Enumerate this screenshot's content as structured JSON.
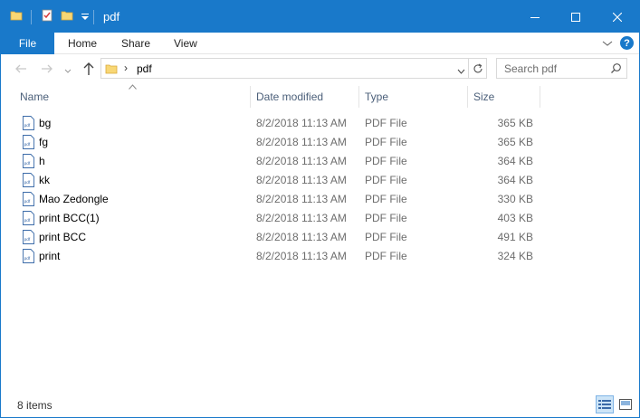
{
  "window": {
    "title": "pdf",
    "accent_color": "#1979ca"
  },
  "quick_access": {
    "icons": [
      "folder-icon",
      "properties-icon",
      "new-folder-icon",
      "customize-dropdown-icon"
    ]
  },
  "title_buttons": {
    "icons": [
      "minimize-icon",
      "maximize-icon",
      "close-icon"
    ]
  },
  "ribbon": {
    "file_label": "File",
    "tabs": [
      {
        "label": "Home"
      },
      {
        "label": "Share"
      },
      {
        "label": "View"
      }
    ],
    "help_label": "?"
  },
  "navigation": {
    "address": {
      "separator": "›",
      "current": "pdf"
    },
    "search": {
      "placeholder": "Search pdf"
    }
  },
  "columns": {
    "name": "Name",
    "date": "Date modified",
    "type": "Type",
    "size": "Size"
  },
  "files": [
    {
      "name": "bg",
      "date": "8/2/2018 11:13 AM",
      "type": "PDF File",
      "size": "365 KB"
    },
    {
      "name": "fg",
      "date": "8/2/2018 11:13 AM",
      "type": "PDF File",
      "size": "365 KB"
    },
    {
      "name": "h",
      "date": "8/2/2018 11:13 AM",
      "type": "PDF File",
      "size": "364 KB"
    },
    {
      "name": "kk",
      "date": "8/2/2018 11:13 AM",
      "type": "PDF File",
      "size": "364 KB"
    },
    {
      "name": "Mao Zedongle",
      "date": "8/2/2018 11:13 AM",
      "type": "PDF File",
      "size": "330 KB"
    },
    {
      "name": "print BCC(1)",
      "date": "8/2/2018 11:13 AM",
      "type": "PDF File",
      "size": "403 KB"
    },
    {
      "name": "print BCC",
      "date": "8/2/2018 11:13 AM",
      "type": "PDF File",
      "size": "491 KB"
    },
    {
      "name": "print",
      "date": "8/2/2018 11:13 AM",
      "type": "PDF File",
      "size": "324 KB"
    }
  ],
  "status": {
    "item_count": "8 items"
  }
}
